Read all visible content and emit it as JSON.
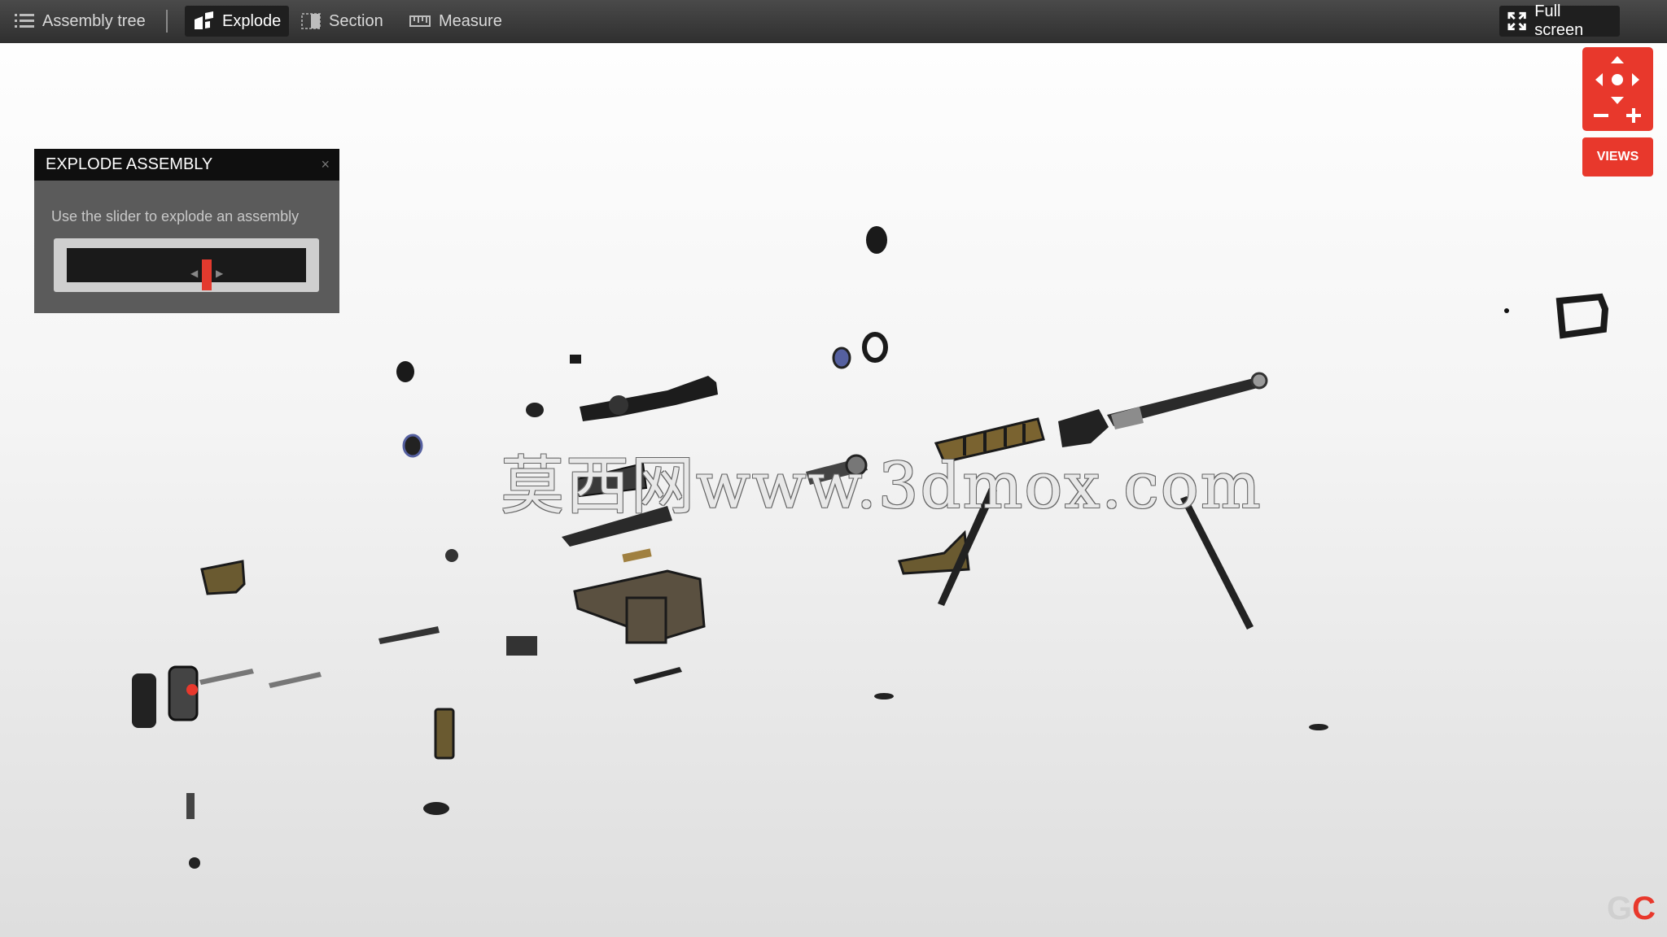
{
  "toolbar": {
    "assembly_tree": "Assembly tree",
    "explode": "Explode",
    "section": "Section",
    "measure": "Measure",
    "full_screen": "Full screen"
  },
  "panel": {
    "title": "EXPLODE ASSEMBLY",
    "close_icon": "×",
    "hint": "Use the slider to explode an assembly"
  },
  "nav": {
    "views_label": "VIEWS"
  },
  "watermark": "莫西网www.3dmox.com",
  "brand": {
    "g": "G",
    "c": "C"
  },
  "colors": {
    "accent": "#e8382c",
    "toolbar": "#3a3a3a",
    "panel": "#5b5b5b",
    "part_dark": "#2a2a2a",
    "part_gold": "#7a6330"
  },
  "icons": [
    "list-icon",
    "explode-icon",
    "section-icon",
    "ruler-icon",
    "expand-icon",
    "pan-arrows-icon",
    "zoom-out-icon",
    "zoom-in-icon",
    "close-icon"
  ]
}
